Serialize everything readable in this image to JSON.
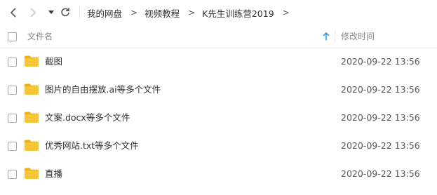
{
  "toolbar": {
    "back_icon": "chevron-left-icon",
    "forward_icon": "chevron-right-icon",
    "history_icon": "caret-down-icon",
    "refresh_icon": "refresh-icon"
  },
  "breadcrumb": {
    "separator": ">",
    "items": [
      "我的网盘",
      "视频教程",
      "K先生训练营2019"
    ]
  },
  "table": {
    "columns": {
      "name": "文件名",
      "modified": "修改时间"
    },
    "sort_icon": "arrow-up-icon",
    "rows": [
      {
        "name": "截图",
        "modified": "2020-09-22 13:56",
        "icon": "folder-icon"
      },
      {
        "name": "图片的自由摆放.ai等多个文件",
        "modified": "2020-09-22 13:56",
        "icon": "folder-icon"
      },
      {
        "name": "文案.docx等多个文件",
        "modified": "2020-09-22 13:56",
        "icon": "folder-icon"
      },
      {
        "name": "优秀网站.txt等多个文件",
        "modified": "2020-09-22 13:56",
        "icon": "folder-icon"
      },
      {
        "name": "直播",
        "modified": "2020-09-22 13:56",
        "icon": "folder-icon"
      }
    ]
  },
  "colors": {
    "folder": "#f6c533",
    "folder_dark": "#e8b020",
    "sort_arrow": "#2b8fe8",
    "icon_active": "#555555",
    "icon_disabled": "#c8c8c8"
  }
}
